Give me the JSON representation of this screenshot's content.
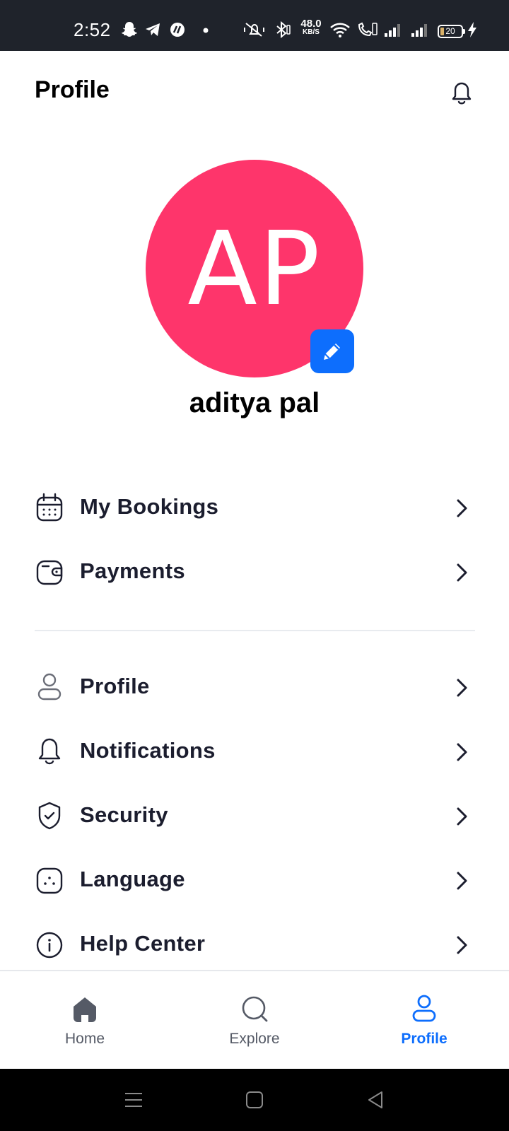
{
  "status_bar": {
    "time": "2:52",
    "net_speed_value": "48.0",
    "net_speed_unit": "KB/S",
    "battery_level": "20",
    "icons": [
      "snapchat-icon",
      "telegram-icon",
      "app-icon",
      "dot-icon",
      "mute-icon",
      "bluetooth-icon",
      "wifi-icon",
      "volte-icon",
      "signal-icon",
      "signal-icon",
      "battery-icon",
      "charging-icon"
    ]
  },
  "header": {
    "title": "Profile",
    "bell_icon": "bell-icon"
  },
  "profile": {
    "initials": "AP",
    "avatar_color": "#FE356B",
    "edit_icon": "pencil-icon",
    "name": "aditya pal"
  },
  "menu": {
    "group1": [
      {
        "label": "My Bookings",
        "icon": "calendar-icon"
      },
      {
        "label": "Payments",
        "icon": "wallet-icon"
      }
    ],
    "group2": [
      {
        "label": "Profile",
        "icon": "user-icon"
      },
      {
        "label": "Notifications",
        "icon": "bell-icon"
      },
      {
        "label": "Security",
        "icon": "shield-check-icon"
      },
      {
        "label": "Language",
        "icon": "language-icon"
      },
      {
        "label": "Help Center",
        "icon": "info-icon"
      }
    ]
  },
  "bottom_nav": {
    "items": [
      {
        "label": "Home",
        "icon": "home-icon"
      },
      {
        "label": "Explore",
        "icon": "search-icon"
      },
      {
        "label": "Profile",
        "icon": "user-icon"
      }
    ],
    "active": "Profile",
    "accent": "#0D6EFD"
  }
}
